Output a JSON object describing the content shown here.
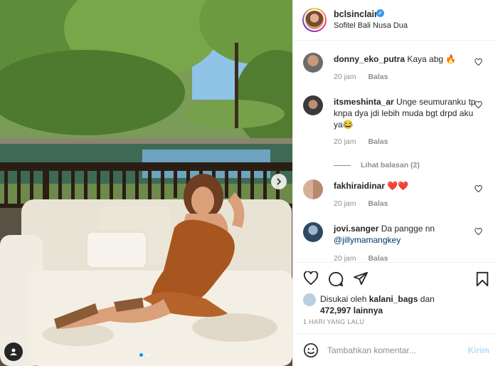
{
  "post": {
    "username": "bclsinclair",
    "location": "Sofitel Bali Nusa Dua",
    "photo_description_icon": "user-tag-icon"
  },
  "comments": [
    {
      "user": "donny_eko_putra",
      "text": "Kaya abg 🔥",
      "time": "20 jam",
      "reply": "Balas"
    },
    {
      "user": "itsmeshinta_ar",
      "text": "Unge seumuranku tp knpa dya jdi lebih muda bgt drpd aku ya😂",
      "time": "20 jam",
      "reply": "Balas",
      "view_replies": "Lihat balasan (2)"
    },
    {
      "user": "fakhiraidinar",
      "text": "❤️❤️",
      "time": "20 jam",
      "reply": "Balas"
    },
    {
      "user": "jovi.sanger",
      "text": "Da pangge nn",
      "mention": "@jillymamangkey",
      "time": "20 jam",
      "reply": "Balas"
    }
  ],
  "likes": {
    "prefix": "Disukai oleh",
    "first_liker": "kalani_bags",
    "conjunction": "dan",
    "count": "472,997",
    "suffix": "lainnya"
  },
  "timestamp": "1 HARI YANG LALU",
  "composer": {
    "placeholder": "Tambahkan komentar...",
    "post_label": "Kirim"
  },
  "colors": {
    "accent": "#0095f6",
    "verified": "#3897f0",
    "post_disabled": "#b2dffc",
    "muted": "#8e8e8e"
  }
}
